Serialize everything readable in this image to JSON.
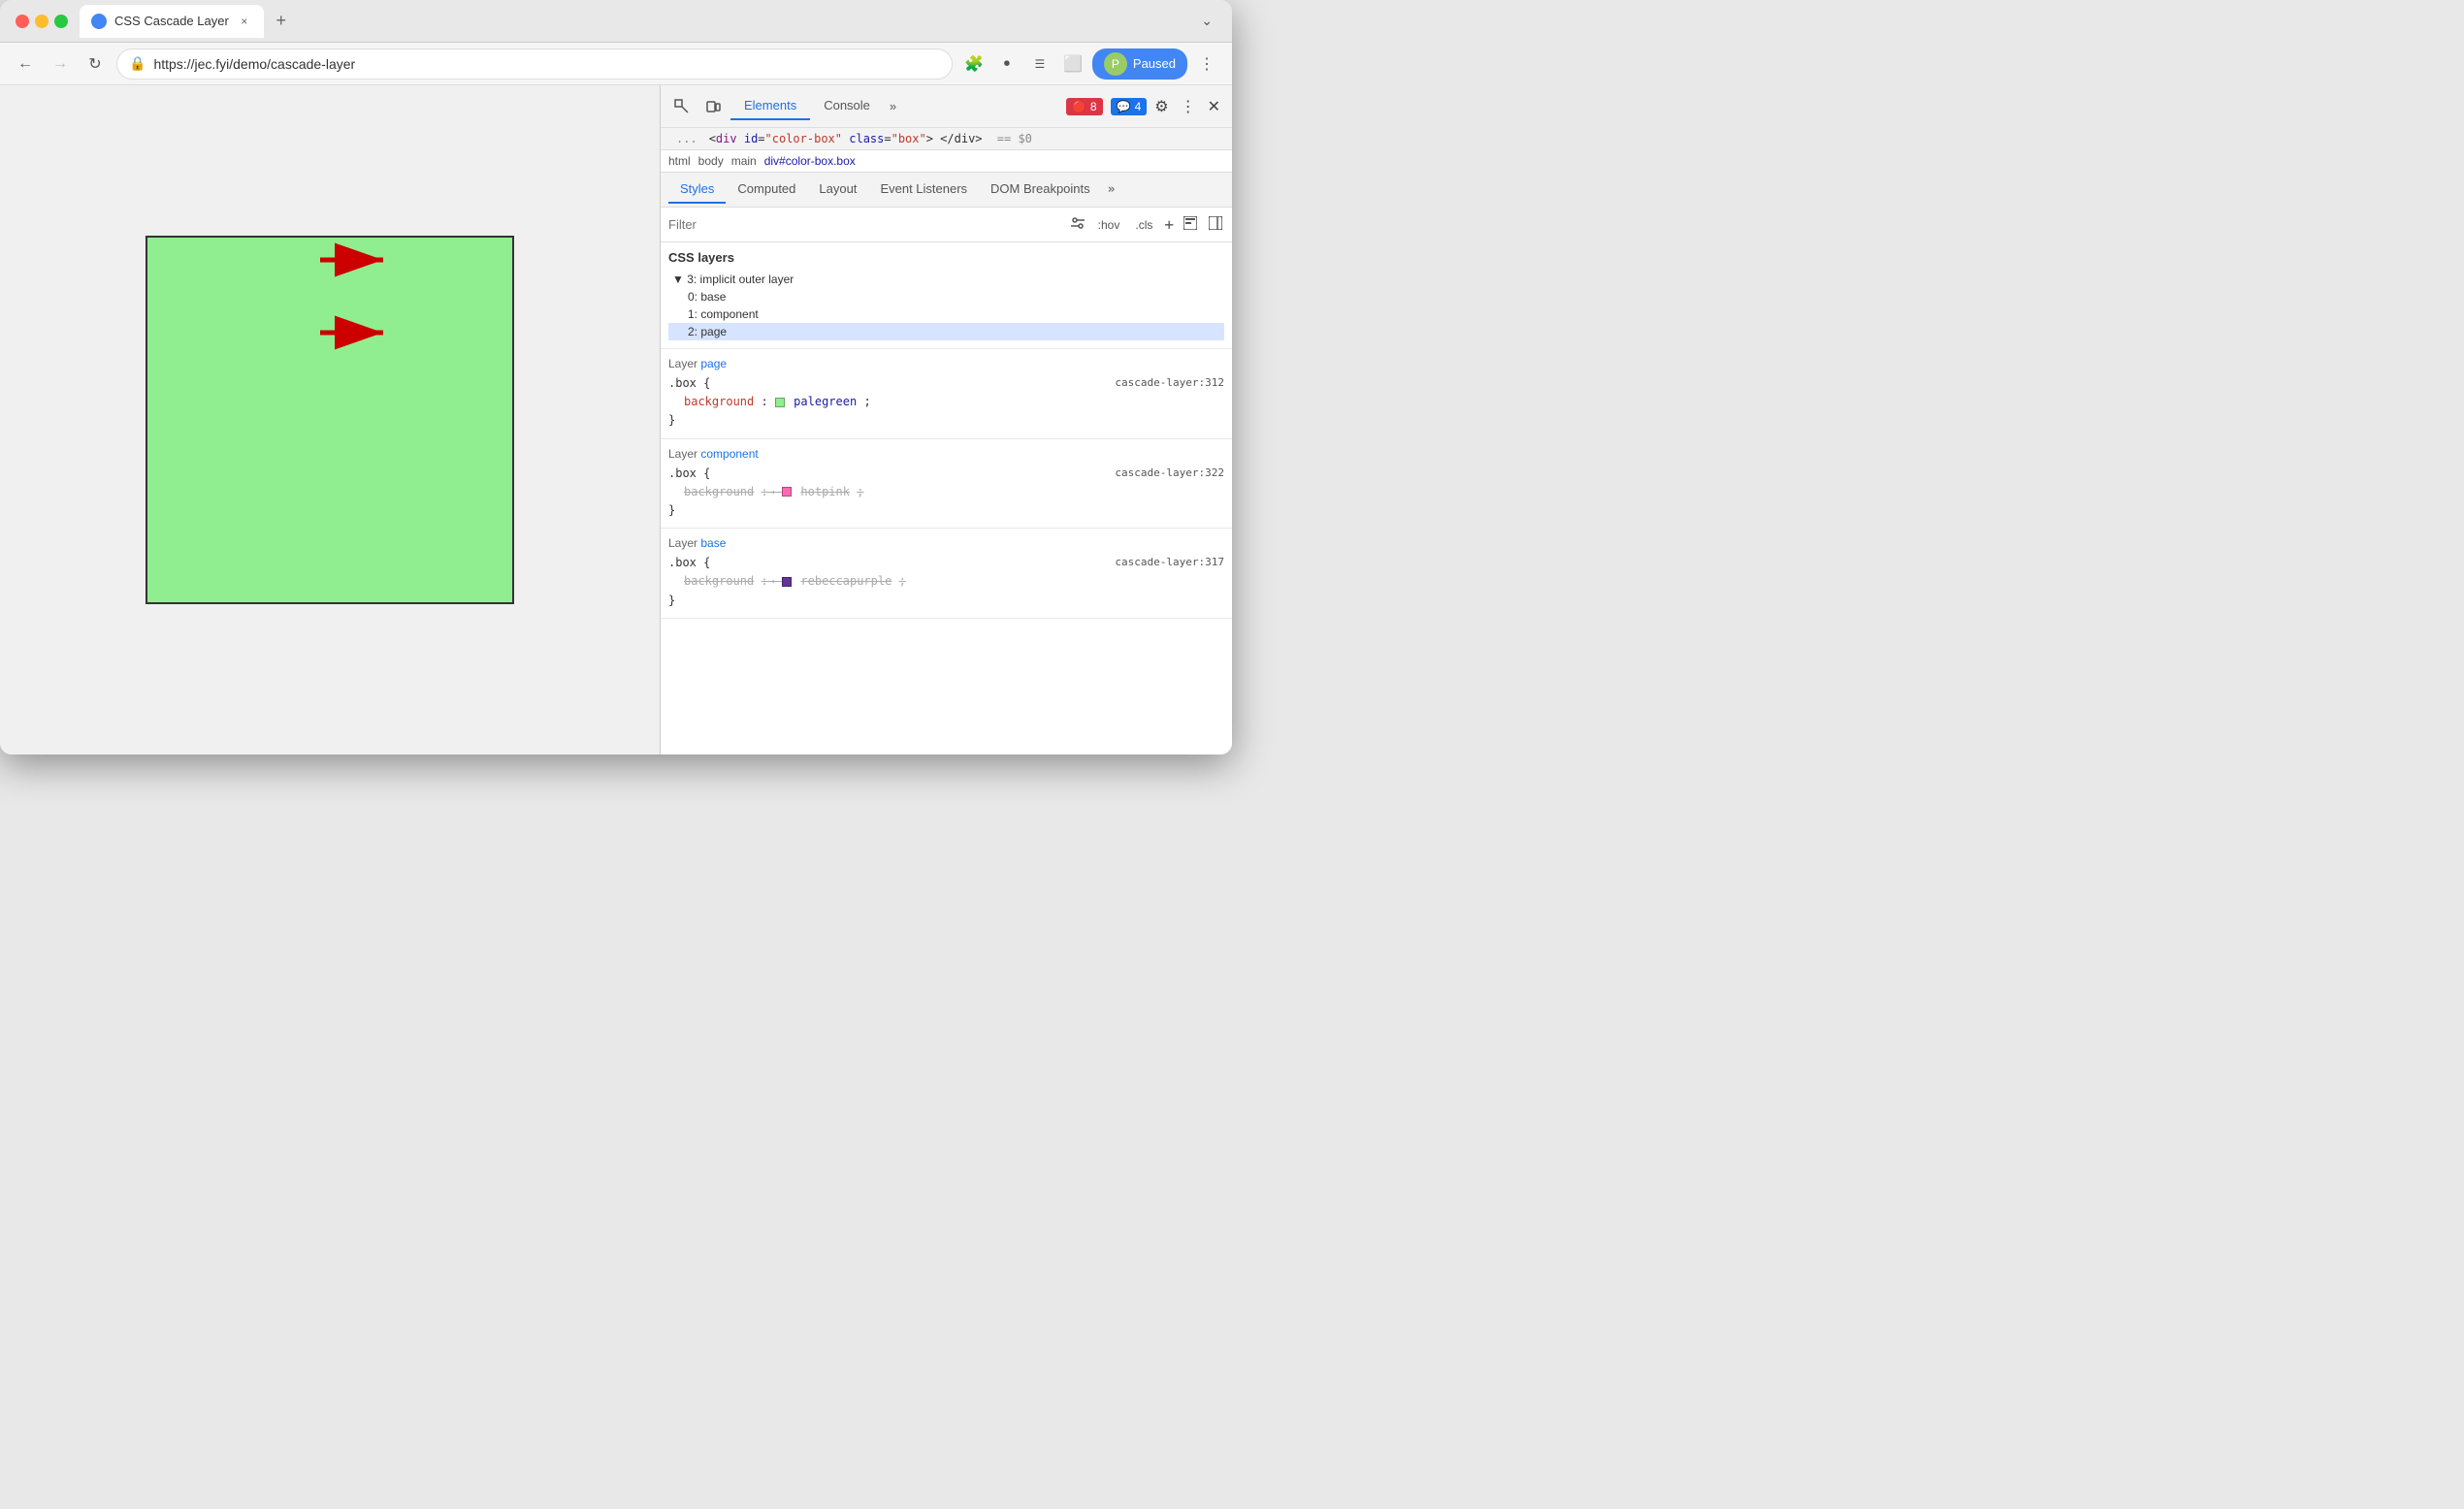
{
  "browser": {
    "tab_title": "CSS Cascade Layer",
    "url": "https://jec.fyi/demo/cascade-layer",
    "back_disabled": false,
    "forward_disabled": true,
    "paused_label": "Paused"
  },
  "devtools": {
    "tabs": [
      "Elements",
      "Console"
    ],
    "active_tab": "Elements",
    "more_tabs_label": "»",
    "errors_count": "8",
    "warnings_count": "4",
    "dom_dots": "...",
    "dom_element_html": "<div id=\"color-box\" class=\"box\"> </div>",
    "dom_selected_marker": "== $0",
    "breadcrumb": [
      "html",
      "body",
      "main",
      "div#color-box.box"
    ],
    "styles_tabs": [
      "Styles",
      "Computed",
      "Layout",
      "Event Listeners",
      "DOM Breakpoints"
    ],
    "active_styles_tab": "Styles",
    "filter_placeholder": "Filter",
    "filter_hov": ":hov",
    "filter_cls": ".cls",
    "css_layers_title": "CSS layers",
    "layers": {
      "outer": "3: implicit outer layer",
      "base": "0: base",
      "component": "1: component",
      "page": "2: page"
    },
    "rules": [
      {
        "layer_label": "Layer",
        "layer_name": "page",
        "selector": ".box",
        "file_ref": "cascade-layer:312",
        "properties": [
          {
            "name": "background",
            "value": "palegreen",
            "color": "#90ee90",
            "strikethrough": false
          }
        ]
      },
      {
        "layer_label": "Layer",
        "layer_name": "component",
        "selector": ".box",
        "file_ref": "cascade-layer:322",
        "properties": [
          {
            "name": "background",
            "value": "hotpink",
            "color": "#ff69b4",
            "strikethrough": true
          }
        ]
      },
      {
        "layer_label": "Layer",
        "layer_name": "base",
        "selector": ".box",
        "file_ref": "cascade-layer:317",
        "properties": [
          {
            "name": "background",
            "value": "rebeccapurple",
            "color": "#663399",
            "strikethrough": true
          }
        ]
      }
    ],
    "arrow1_label": "CSS layers",
    "arrow2_label": "Layer page"
  }
}
